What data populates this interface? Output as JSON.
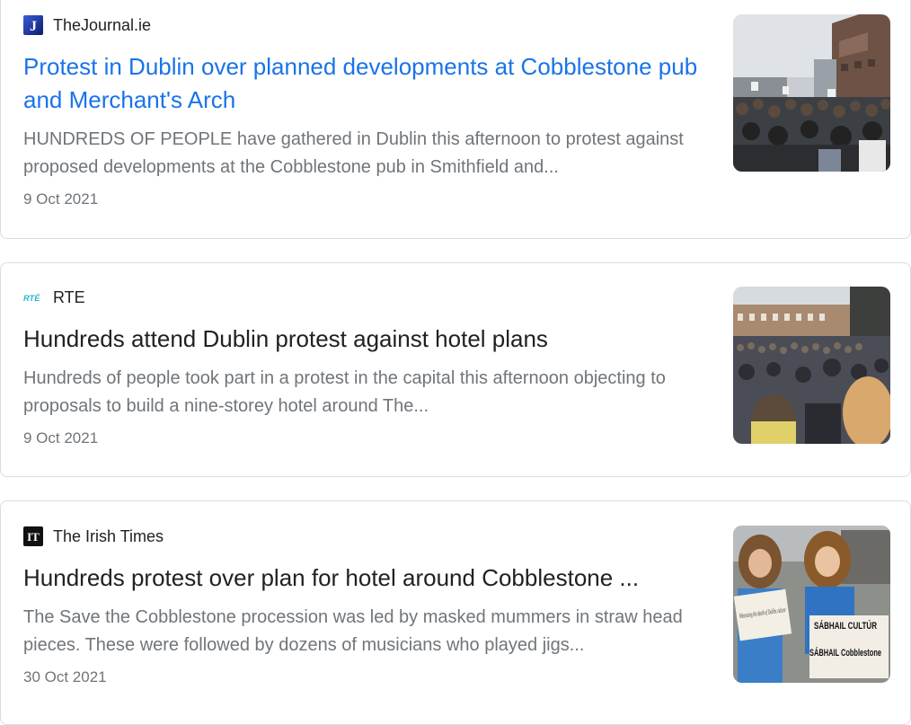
{
  "results": [
    {
      "source": "TheJournal.ie",
      "favicon_icon": "thejournal-j-logo",
      "favicon_letter": "J",
      "title": "Protest in Dublin over planned developments at Cobblestone pub and Merchant's Arch",
      "title_color": "#1a73e8",
      "snippet": "HUNDREDS OF PEOPLE have gathered in Dublin this afternoon to protest against proposed developments at the Cobblestone pub in Smithfield and...",
      "date": "9 Oct 2021",
      "thumbnail": "crowd-street-photo"
    },
    {
      "source": "RTE",
      "favicon_icon": "rte-logo",
      "favicon_letter": "RTÉ",
      "title": "Hundreds attend Dublin protest against hotel plans",
      "title_color": "#202124",
      "snippet": "Hundreds of people took part in a protest in the capital this afternoon objecting to proposals to build a nine-storey hotel around The...",
      "date": "9 Oct 2021",
      "thumbnail": "crowd-quays-photo"
    },
    {
      "source": "The Irish Times",
      "favicon_icon": "irish-times-logo",
      "favicon_letter": "IT",
      "title": "Hundreds protest over plan for hotel around Cobblestone ...",
      "title_color": "#202124",
      "snippet": "The Save the Cobblestone procession was led by masked mummers in straw head pieces. These were followed by dozens of musicians who played jigs...",
      "date": "30 Oct 2021",
      "thumbnail": "protesters-signs-photo",
      "sign_texts": [
        "Witnessing the death of Dublin culture",
        "SÁBHAIL CULTÚR",
        "SÁBHAIL Cobblestone"
      ]
    }
  ]
}
